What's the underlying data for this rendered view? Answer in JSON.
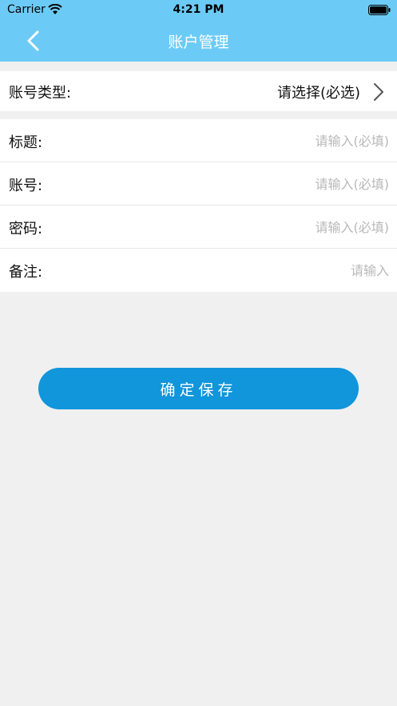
{
  "status_bar": {
    "carrier": "Carrier",
    "time": "4:21 PM"
  },
  "nav": {
    "title": "账户管理"
  },
  "account_type": {
    "label": "账号类型:",
    "value": "请选择(必选)"
  },
  "fields": [
    {
      "label": "标题:",
      "placeholder": "请输入(必填)",
      "value": ""
    },
    {
      "label": "账号:",
      "placeholder": "请输入(必填)",
      "value": ""
    },
    {
      "label": "密码:",
      "placeholder": "请输入(必填)",
      "value": ""
    },
    {
      "label": "备注:",
      "placeholder": "请输入",
      "value": ""
    }
  ],
  "save_label": "确定保存",
  "colors": {
    "nav_bg": "#6ccbf6",
    "button_bg": "#1195db",
    "page_bg": "#f0f0f0"
  }
}
